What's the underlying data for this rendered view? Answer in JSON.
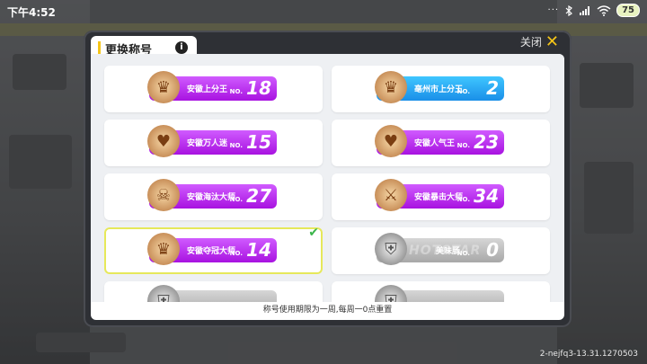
{
  "status_bar": {
    "time": "下午4:52",
    "signal_dots": "···",
    "battery": "75"
  },
  "dialog": {
    "title": "更换称号",
    "info_icon": "i",
    "close_label": "关闭",
    "close_icon": "✕",
    "footer_note": "称号使用期限为一周,每周一0点重置",
    "cards": [
      {
        "title": "安徽上分王",
        "no_prefix": "NO.",
        "rank": "18",
        "style": "purple",
        "emblem": "crown-icon",
        "selected": false
      },
      {
        "title": "亳州市上分王",
        "no_prefix": "NO.",
        "rank": "2",
        "style": "blue",
        "emblem": "crown-icon",
        "selected": false
      },
      {
        "title": "安徽万人迷",
        "no_prefix": "NO.",
        "rank": "15",
        "style": "purple",
        "emblem": "heart-icon",
        "selected": false
      },
      {
        "title": "安徽人气王",
        "no_prefix": "NO.",
        "rank": "23",
        "style": "purple",
        "emblem": "heart-icon",
        "selected": false
      },
      {
        "title": "安徽海汰大师",
        "no_prefix": "NO.",
        "rank": "27",
        "style": "purple",
        "emblem": "skull-icon",
        "selected": false
      },
      {
        "title": "安徽暴击大师",
        "no_prefix": "NO.",
        "rank": "34",
        "style": "purple",
        "emblem": "sword-icon",
        "selected": false
      },
      {
        "title": "安徽夺冠大师",
        "no_prefix": "NO.",
        "rank": "14",
        "style": "purple",
        "emblem": "crown-icon",
        "selected": true,
        "check": "✔"
      },
      {
        "title": "美味肠",
        "no_prefix": "NO.",
        "rank": "0",
        "style": "gray",
        "emblem": "shield-icon",
        "selected": false,
        "watermark": "HOTSTAR"
      }
    ]
  },
  "version_text": "2-nejfq3-13.31.1270503",
  "colors": {
    "accent": "#f5c518",
    "purple_badge": "#b62ff0",
    "blue_badge": "#2aa6f2",
    "gray_badge": "#bdbdbd",
    "check": "#3bb54a"
  }
}
